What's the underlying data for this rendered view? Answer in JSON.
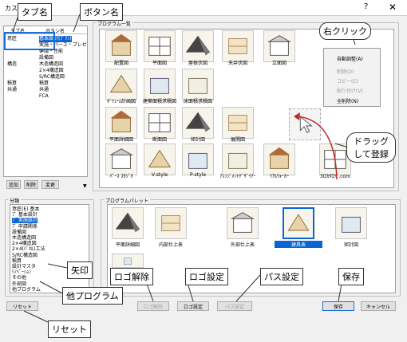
{
  "window": {
    "title": "カスタマイズ",
    "help": "?",
    "close": "✕"
  },
  "tabs_list": {
    "headers": [
      "タブ名",
      "ボタン名"
    ],
    "rows": [
      {
        "tab": "意匠",
        "button": "基本設計(ﾌﾟﾗﾝ)"
      },
      {
        "tab": "",
        "button": "実施・パース・プレゼン"
      },
      {
        "tab": "",
        "button": "申請・性能"
      },
      {
        "tab": "",
        "button": "設備図"
      },
      {
        "tab": "構造",
        "button": "木造構造図"
      },
      {
        "tab": "",
        "button": "2×4構造図"
      },
      {
        "tab": "",
        "button": "S/RC構造図"
      },
      {
        "tab": "積算",
        "button": "積算"
      },
      {
        "tab": "共通",
        "button": "共通"
      },
      {
        "tab": "",
        "button": "FCA"
      }
    ]
  },
  "list_buttons": {
    "add": "追加",
    "delete": "削除",
    "change": "変更"
  },
  "program_list": {
    "title": "プログラム一覧",
    "items": [
      "配置図",
      "平面図",
      "屋根伏図",
      "天井伏図",
      "立面図",
      "ﾎﾞﾘｭｰﾑ計画図",
      "建築面積求積図",
      "床面積求積図",
      "平面詳細図",
      "断面図",
      "矩計図",
      "展開図",
      "ﾊﾟｰｽ ｽﾀｼﾞｵ",
      "V-style",
      "P-style",
      "ｱﾚﾝｼﾞﾒﾝﾄﾃﾞｻﾞｲﾅｰ",
      "ﾘｱﾙｳｫｰｶｰ",
      "3Dｶﾀﾛｸﾞ.com"
    ]
  },
  "context_menu": {
    "items": [
      {
        "label": "自動調整(A)",
        "enabled": true
      },
      {
        "label": "削除(D)",
        "enabled": false
      },
      {
        "label": "コピー(C)",
        "enabled": false
      },
      {
        "label": "貼り付け(V)",
        "enabled": false
      },
      {
        "label": "全削除(N)",
        "enabled": true
      }
    ]
  },
  "category": {
    "title": "分類",
    "items": [
      "意匠(E) 基本",
      "ﾌﾟ 基本設計",
      "ﾌﾟ 実施設計",
      "ﾌﾟ 申請関係",
      "設備図",
      "木造構造図",
      "2×4構造図",
      "2×4(ﾊﾟﾈﾙ)工法",
      "S/RC構造図",
      "積算",
      "設計マスタ",
      "ﾘﾉﾍﾞｰｼｮﾝ",
      "その他",
      "外部図",
      "他プログラム"
    ],
    "selected_index": 2
  },
  "palette": {
    "title": "プログラムパレット",
    "items": [
      "平面詳細図",
      "内部仕上表",
      "外部仕上表",
      "建具表",
      "矩計図"
    ],
    "selected_index": 3
  },
  "bottom_buttons": {
    "reset": "リセット",
    "logo_clear": "ロゴ解除",
    "logo_set": "ロゴ設定",
    "path_set": "パス設定",
    "save": "保存",
    "cancel": "キャンセル"
  },
  "annotations": {
    "tab_name": "タブ名",
    "button_name": "ボタン名",
    "right_click": "右クリック",
    "drag_register": "ドラッグして登録",
    "arrow": "矢印",
    "other_program": "他プログラム",
    "logo_clear": "ロゴ解除",
    "logo_set": "ロゴ設定",
    "path_set": "パス設定",
    "save": "保存",
    "reset": "リセット"
  },
  "colors": {
    "selection": "#0a64d2",
    "annotation_box": "#1a6fd8",
    "drag_arrow": "#c0282a"
  }
}
